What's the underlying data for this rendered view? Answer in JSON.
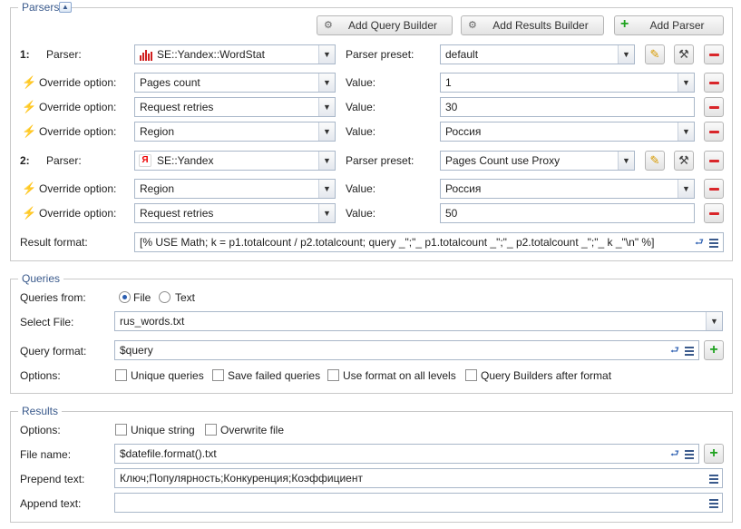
{
  "parsers": {
    "legend": "Parsers",
    "add_query_builder": "Add Query Builder",
    "add_results_builder": "Add Results Builder",
    "add_parser": "Add Parser",
    "parser_label": "Parser:",
    "preset_label": "Parser preset:",
    "override_label": "Override option:",
    "value_label": "Value:",
    "result_format_label": "Result format:",
    "result_format": "[% USE Math; k = p1.totalcount / p2.totalcount; query _\";\"_ p1.totalcount _\";\"_ p2.totalcount _\";\"_ k _\"\\n\" %]",
    "p1": {
      "num": "1:",
      "name": "SE::Yandex::WordStat",
      "preset": "default",
      "overrides": [
        {
          "option": "Pages count",
          "value": "1"
        },
        {
          "option": "Request retries",
          "value": "30"
        },
        {
          "option": "Region",
          "value": "Россия"
        }
      ]
    },
    "p2": {
      "num": "2:",
      "name": "SE::Yandex",
      "preset": "Pages Count use Proxy",
      "overrides": [
        {
          "option": "Region",
          "value": "Россия"
        },
        {
          "option": "Request retries",
          "value": "50"
        }
      ]
    }
  },
  "queries": {
    "legend": "Queries",
    "from_label": "Queries from:",
    "file_option": "File",
    "text_option": "Text",
    "select_file_label": "Select File:",
    "file": "rus_words.txt",
    "format_label": "Query format:",
    "format": "$query",
    "options_label": "Options:",
    "opt1": "Unique queries",
    "opt2": "Save failed queries",
    "opt3": "Use format on all levels",
    "opt4": "Query Builders after format"
  },
  "results": {
    "legend": "Results",
    "options_label": "Options:",
    "opt1": "Unique string",
    "opt2": "Overwrite file",
    "filename_label": "File name:",
    "filename": "$datefile.format().txt",
    "prepend_label": "Prepend text:",
    "prepend": "Ключ;Популярность;Конкуренция;Коэффициент",
    "append_label": "Append text:",
    "append": ""
  }
}
